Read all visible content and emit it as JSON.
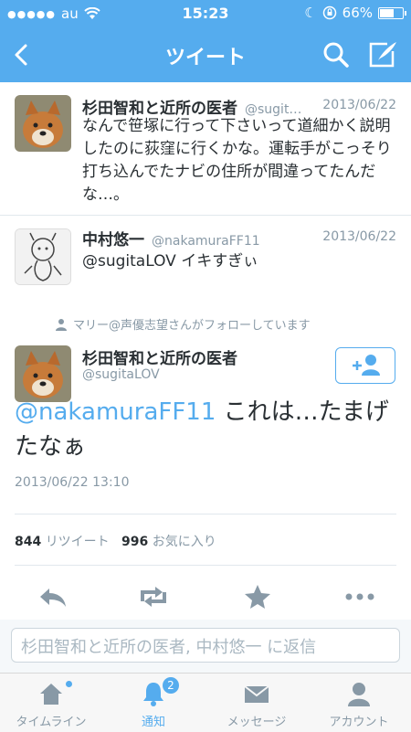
{
  "status": {
    "carrier": "au",
    "time": "15:23",
    "battery": "66%",
    "battery_level": 0.66
  },
  "nav": {
    "title": "ツイート"
  },
  "tweets": [
    {
      "name": "杉田智和と近所の医者",
      "handle": "@sugit…",
      "date": "2013/06/22",
      "text": "なんで笹塚に行って下さいって道細かく説明したのに荻窪に行くかな。運転手がこっそり打ち込んでたナビの住所が間違ってたんだな…。"
    },
    {
      "name": "中村悠一",
      "handle": "@nakamuraFF11",
      "date": "2013/06/22",
      "text": "@sugitaLOV イキすぎぃ"
    }
  ],
  "main": {
    "followed_by": "マリー@声優志望さんがフォローしています",
    "name": "杉田智和と近所の医者",
    "handle": "@sugitaLOV",
    "mention": "@nakamuraFF11",
    "text_rest": " これは…たまげたなぁ",
    "timestamp": "2013/06/22 13:10",
    "retweet_count": "844",
    "retweet_label": "リツイート",
    "fav_count": "996",
    "fav_label": "お気に入り"
  },
  "reply": {
    "placeholder": "杉田智和と近所の医者, 中村悠一 に返信"
  },
  "tabs": [
    {
      "label": "タイムライン"
    },
    {
      "label": "通知",
      "badge": "2"
    },
    {
      "label": "メッセージ"
    },
    {
      "label": "アカウント"
    }
  ],
  "colors": {
    "accent": "#55acee",
    "text": "#292f33",
    "muted": "#8899a6"
  }
}
